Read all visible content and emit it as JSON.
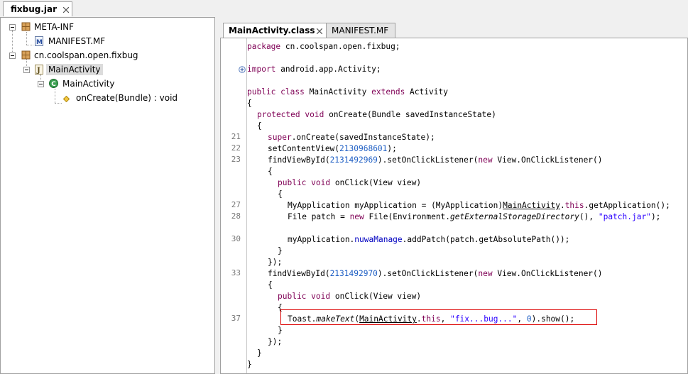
{
  "outer_tab": {
    "label": "fixbug.jar"
  },
  "tree": {
    "nodes": [
      {
        "label": "META-INF"
      },
      {
        "label": "MANIFEST.MF"
      },
      {
        "label": "cn.coolspan.open.fixbug"
      },
      {
        "label": "MainActivity"
      },
      {
        "label": "MainActivity"
      },
      {
        "label": "onCreate(Bundle) : void"
      }
    ]
  },
  "editor": {
    "tabs": [
      {
        "label": "MainActivity.class"
      },
      {
        "label": "MANIFEST.MF"
      }
    ],
    "line_numbers": [
      "21",
      "22",
      "23",
      "27",
      "28",
      "30",
      "33",
      "37"
    ],
    "code": {
      "l0": [
        "package",
        " cn.coolspan.open.fixbug;"
      ],
      "l1": [
        "import",
        " android.app.Activity;"
      ],
      "l2": [
        "public",
        " ",
        "class",
        " MainActivity ",
        "extends",
        " Activity"
      ],
      "l3": [
        "{"
      ],
      "l4": [
        "protected",
        " ",
        "void",
        " onCreate(Bundle savedInstanceState)"
      ],
      "l5": [
        "{"
      ],
      "l6": [
        "super",
        ".onCreate(savedInstanceState);"
      ],
      "l7": [
        "setContentView(",
        "2130968601",
        ");"
      ],
      "l8": [
        "findViewById(",
        "2131492969",
        ").setOnClickListener(",
        "new",
        " View.OnClickListener()"
      ],
      "l9": [
        "{"
      ],
      "l10": [
        "public",
        " ",
        "void",
        " onClick(View view)"
      ],
      "l11": [
        "{"
      ],
      "l12": [
        "MyApplication myApplication = (MyApplication)",
        "MainActivity",
        ".",
        "this",
        ".getApplication();"
      ],
      "l13": [
        "File patch = ",
        "new",
        " File(Environment.",
        "getExternalStorageDirectory",
        "(), ",
        "\"patch.jar\"",
        ");"
      ],
      "l14": [
        "myApplication.",
        "nuwaManage",
        ".addPatch(patch.getAbsolutePath());"
      ],
      "l15": [
        "}"
      ],
      "l16": [
        "});"
      ],
      "l17": [
        "findViewById(",
        "2131492970",
        ").setOnClickListener(",
        "new",
        " View.OnClickListener()"
      ],
      "l18": [
        "{"
      ],
      "l19": [
        "public",
        " ",
        "void",
        " onClick(View view)"
      ],
      "l20": [
        "{"
      ],
      "l21": [
        "Toast.",
        "makeText",
        "(",
        "MainActivity",
        ".",
        "this",
        ", ",
        "\"fix...bug...\"",
        ", ",
        "0",
        ").show();"
      ],
      "l22": [
        "}"
      ],
      "l23": [
        "});"
      ],
      "l24": [
        "}"
      ],
      "l25": [
        "}"
      ]
    }
  }
}
